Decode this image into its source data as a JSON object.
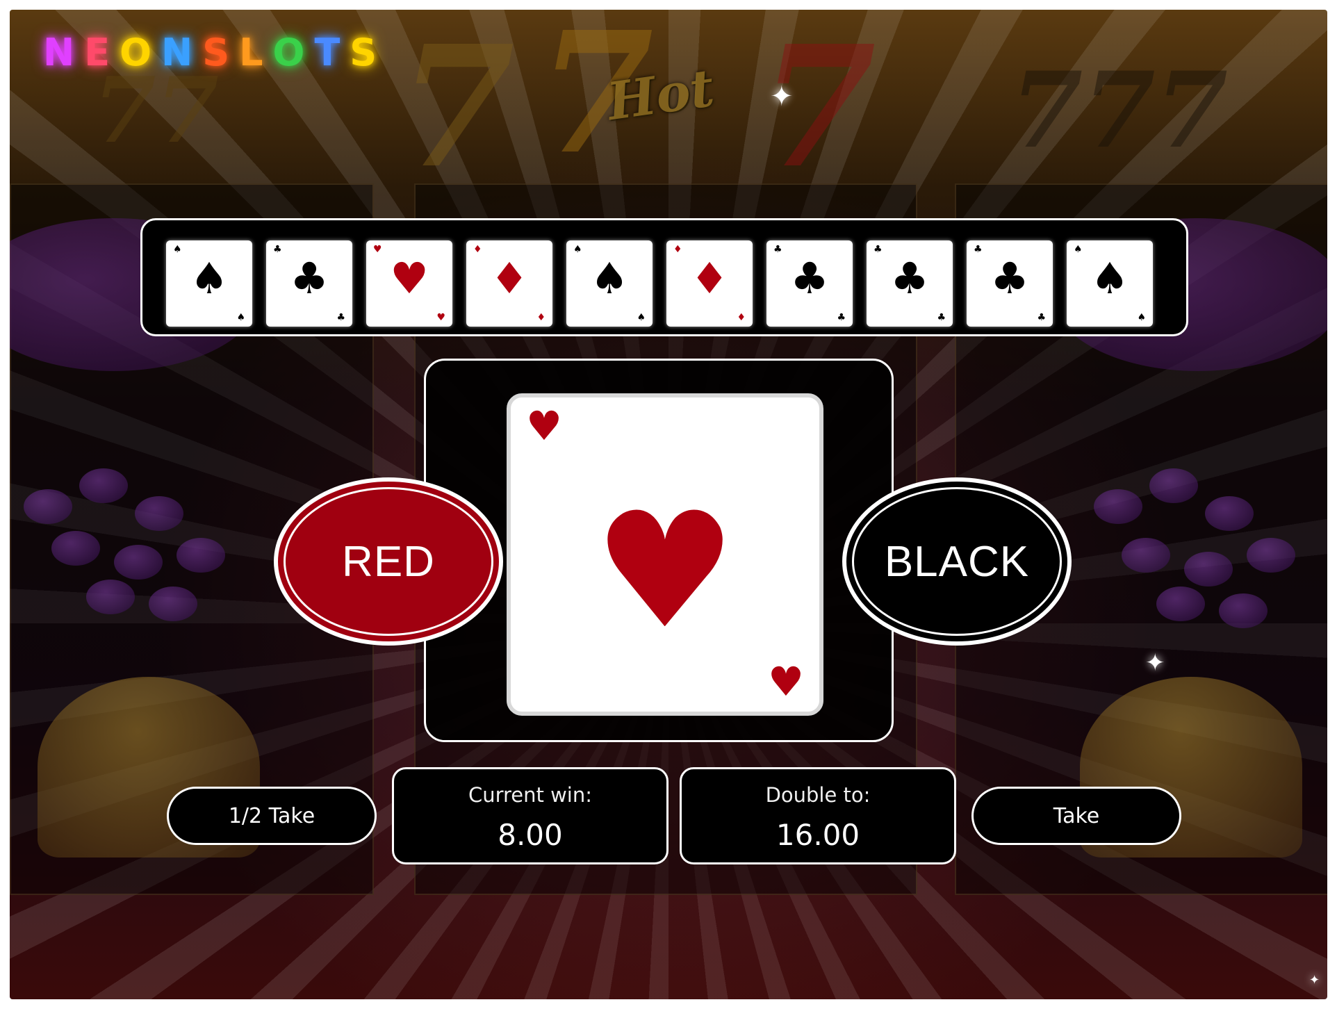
{
  "logo": {
    "letters": [
      "N",
      "E",
      "O",
      "N",
      "S",
      "L",
      "O",
      "T",
      "S"
    ],
    "colors": [
      "#e040ff",
      "#ff4a6a",
      "#ffd400",
      "#3aa0ff",
      "#ff5a1e",
      "#ff9a1e",
      "#3ad14a",
      "#4a8aff",
      "#ffd400"
    ]
  },
  "game_logo": "Hot",
  "history": [
    {
      "suit": "♠",
      "color": "#000000"
    },
    {
      "suit": "♣",
      "color": "#000000"
    },
    {
      "suit": "♥",
      "color": "#b00010"
    },
    {
      "suit": "♦",
      "color": "#b00010"
    },
    {
      "suit": "♠",
      "color": "#000000"
    },
    {
      "suit": "♦",
      "color": "#b00010"
    },
    {
      "suit": "♣",
      "color": "#000000"
    },
    {
      "suit": "♣",
      "color": "#000000"
    },
    {
      "suit": "♣",
      "color": "#000000"
    },
    {
      "suit": "♠",
      "color": "#000000"
    }
  ],
  "current_card": {
    "suit": "♥",
    "color": "#b00010"
  },
  "buttons": {
    "red": "RED",
    "black": "BLACK",
    "half_take": "1/2 Take",
    "take": "Take"
  },
  "info": {
    "current_win_label": "Current win:",
    "current_win_value": "8.00",
    "double_to_label": "Double to:",
    "double_to_value": "16.00"
  },
  "colors": {
    "red_button": "#a00010",
    "black_button": "#000000",
    "border": "#ffffff"
  }
}
